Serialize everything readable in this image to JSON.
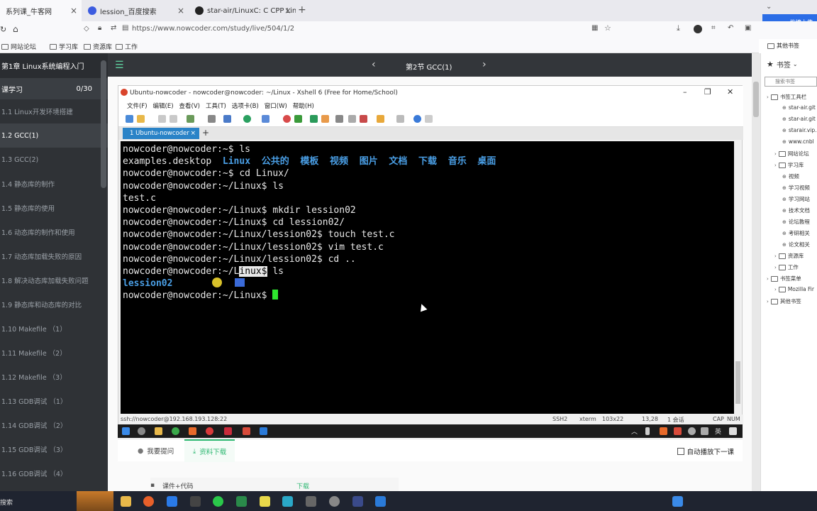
{
  "browser": {
    "tabs": [
      {
        "label": "系列课_牛客网",
        "active": true
      },
      {
        "label": "lession_百度搜索",
        "active": false
      },
      {
        "label": "star-air/LinuxC: C CPP Linux I",
        "active": false
      }
    ],
    "url": "https://www.nowcoder.com/study/live/504/1/2",
    "baidu_upload": "拖拽上传",
    "bookmarks": [
      "网站论坛",
      "学习库",
      "资源库",
      "工作"
    ],
    "other_bookmarks": "其他书签"
  },
  "course": {
    "chapter_header": "第1章 Linux系统编程入门",
    "section_label": "课学习",
    "progress": "0/30",
    "lessons": [
      {
        "label": "1.1 Linux开发环境搭建",
        "active": false
      },
      {
        "label": "1.2 GCC(1)",
        "active": true
      },
      {
        "label": "1.3 GCC(2)",
        "active": false
      },
      {
        "label": "1.4 静态库的制作",
        "active": false
      },
      {
        "label": "1.5 静态库的使用",
        "active": false
      },
      {
        "label": "1.6 动态库的制作和使用",
        "active": false
      },
      {
        "label": "1.7 动态库加载失败的原因",
        "active": false
      },
      {
        "label": "1.8 解决动态库加载失败问题",
        "active": false
      },
      {
        "label": "1.9 静态库和动态库的对比",
        "active": false
      },
      {
        "label": "1.10 Makefile （1）",
        "active": false
      },
      {
        "label": "1.11 Makefile （2）",
        "active": false
      },
      {
        "label": "1.12 Makefile （3）",
        "active": false
      },
      {
        "label": "1.13 GDB调试 （1）",
        "active": false
      },
      {
        "label": "1.14 GDB调试 （2）",
        "active": false
      },
      {
        "label": "1.15 GDB调试 （3）",
        "active": false
      },
      {
        "label": "1.16 GDB调试 （4）",
        "active": false
      }
    ],
    "current_section": "第2节 GCC(1)"
  },
  "xshell": {
    "title": "Ubuntu-nowcoder - nowcoder@nowcoder: ~/Linux - Xshell 6 (Free for Home/School)",
    "menu": [
      "文件(F)",
      "编辑(E)",
      "查看(V)",
      "工具(T)",
      "选项卡(B)",
      "窗口(W)",
      "帮助(H)"
    ],
    "session_tab": "1 Ubuntu-nowcoder",
    "terminal": {
      "l1": "nowcoder@nowcoder:~$ ls",
      "l2_a": "examples.desktop  ",
      "l2_dirs": [
        "Linux",
        "公共的",
        "模板",
        "视频",
        "图片",
        "文档",
        "下载",
        "音乐",
        "桌面"
      ],
      "l3": "nowcoder@nowcoder:~$ cd Linux/",
      "l4": "nowcoder@nowcoder:~/Linux$ ls",
      "l5": "test.c",
      "l6": "nowcoder@nowcoder:~/Linux$ mkdir lession02",
      "l7": "nowcoder@nowcoder:~/Linux$ cd lession02/",
      "l8": "nowcoder@nowcoder:~/Linux/lession02$ touch test.c",
      "l9": "nowcoder@nowcoder:~/Linux/lession02$ vim test.c",
      "l10": "nowcoder@nowcoder:~/Linux/lession02$ cd ..",
      "l11_a": "nowcoder@nowcoder:~/L",
      "l11_hl": "inux$",
      "l11_b": " ls",
      "l12": "lession02",
      "l13": "nowcoder@nowcoder:~/Linux$ "
    },
    "status": {
      "host": "ssh://nowcoder@192.168.193.128:22",
      "protocol": "SSH2",
      "term": "xterm",
      "size": "103x22",
      "pos": "13,28",
      "sessions": "1 会话",
      "caps": "CAP",
      "num": "NUM"
    }
  },
  "panel": {
    "tab_ask": "我要提问",
    "tab_download": "资料下载",
    "autoplay": "自动播放下一课",
    "material_name": "课件+代码",
    "material_action": "下载"
  },
  "bookmarks_panel": {
    "title": "书签",
    "search_placeholder": "搜索书签",
    "items": [
      {
        "label": "书签工具栏",
        "indent": 0
      },
      {
        "label": "star-air.git",
        "indent": 2
      },
      {
        "label": "star-air.git",
        "indent": 2
      },
      {
        "label": "starair.vip.",
        "indent": 2
      },
      {
        "label": "www.cnbl",
        "indent": 2
      },
      {
        "label": "网站论坛",
        "indent": 1
      },
      {
        "label": "学习库",
        "indent": 1
      },
      {
        "label": "视频",
        "indent": 2
      },
      {
        "label": "学习视频",
        "indent": 2
      },
      {
        "label": "学习网站",
        "indent": 2
      },
      {
        "label": "技术文档",
        "indent": 2
      },
      {
        "label": "论坛教程",
        "indent": 2
      },
      {
        "label": "考研相关",
        "indent": 2
      },
      {
        "label": "论文相关",
        "indent": 2
      },
      {
        "label": "资源库",
        "indent": 1
      },
      {
        "label": "工作",
        "indent": 1
      },
      {
        "label": "书签菜单",
        "indent": 0
      },
      {
        "label": "Mozilla Fir",
        "indent": 1
      },
      {
        "label": "其他书签",
        "indent": 0
      }
    ]
  },
  "taskbar": {
    "search": "搜索"
  }
}
